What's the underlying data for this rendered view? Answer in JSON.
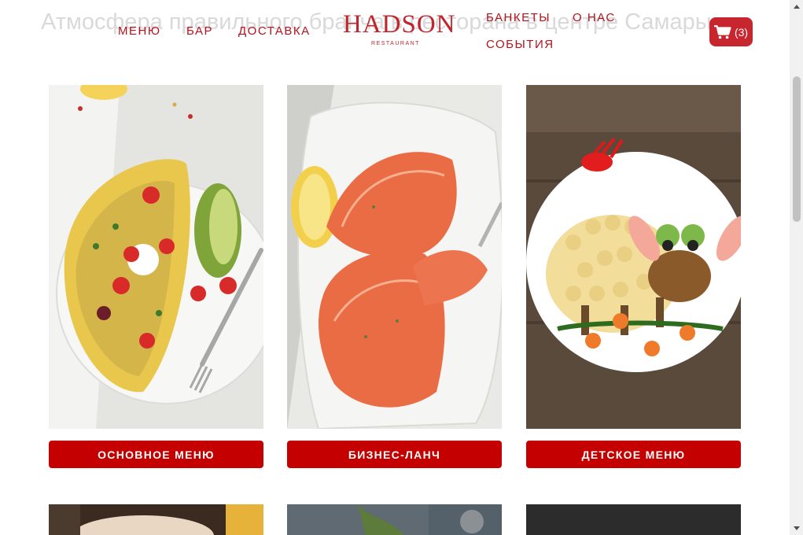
{
  "background_heading": "Атмосфера правильного бранча в ресторана в центре Самары",
  "nav": {
    "menu": "МЕНЮ",
    "bar": "БАР",
    "delivery": "ДОСТАВКА",
    "banquets": "БАНКЕТЫ",
    "about": "О НАС",
    "events": "СОБЫТИЯ"
  },
  "logo": {
    "main": "HADSON",
    "sub": "RESTAURANT"
  },
  "cart": {
    "count": "(3)",
    "icon": "cart-icon"
  },
  "cards": [
    {
      "label": "ОСНОВНОЕ МЕНЮ",
      "image": "omelette-photo"
    },
    {
      "label": "БИЗНЕС-ЛАНЧ",
      "image": "salmon-photo"
    },
    {
      "label": "ДЕТСКОЕ МЕНЮ",
      "image": "kids-pasta-photo"
    }
  ],
  "colors": {
    "accent": "#c50000",
    "nav_text": "#b3131d",
    "cart_bg": "#c8262e"
  }
}
